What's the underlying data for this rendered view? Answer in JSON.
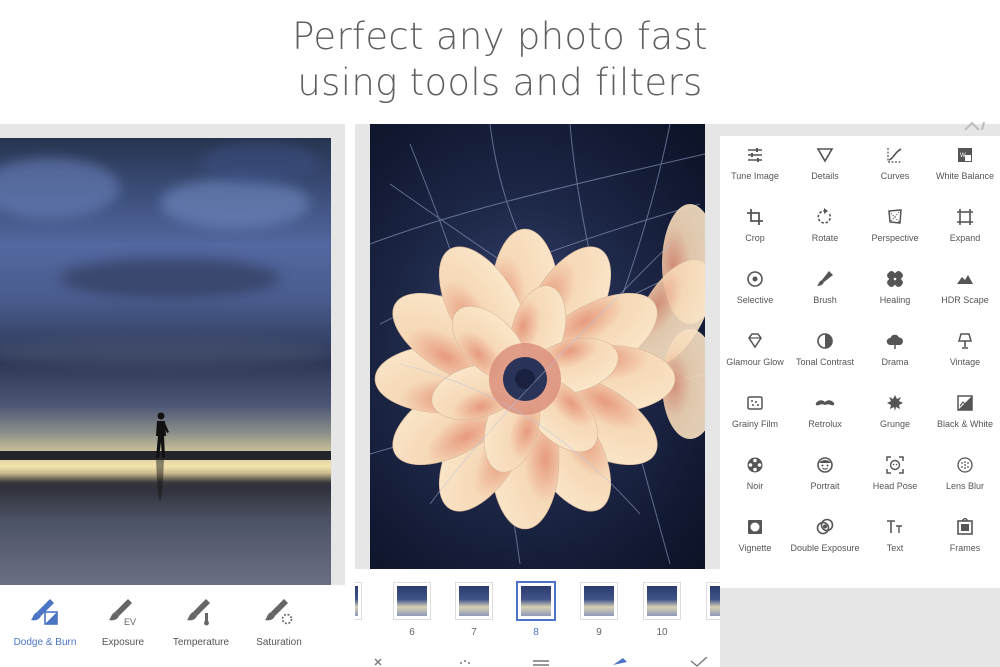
{
  "headline": {
    "line1": "Perfect any photo fast",
    "line2": "using tools and filters"
  },
  "left_toolbar": {
    "active_color": "#4b75c4",
    "items": [
      {
        "label": "Dodge & Burn",
        "icon": "dodge-burn-brush-icon",
        "active": true
      },
      {
        "label": "Exposure",
        "icon": "exposure-brush-icon",
        "active": false
      },
      {
        "label": "Temperature",
        "icon": "temperature-brush-icon",
        "active": false
      },
      {
        "label": "Saturation",
        "icon": "saturation-brush-icon",
        "active": false
      }
    ]
  },
  "filmstrip": {
    "selected": "8",
    "thumbs": [
      "6",
      "7",
      "8",
      "9",
      "10"
    ]
  },
  "tools": [
    {
      "label": "Tune Image",
      "icon": "tune-sliders-icon"
    },
    {
      "label": "Details",
      "icon": "details-triangle-icon"
    },
    {
      "label": "Curves",
      "icon": "curves-icon"
    },
    {
      "label": "White Balance",
      "icon": "white-balance-icon"
    },
    {
      "label": "Crop",
      "icon": "crop-icon"
    },
    {
      "label": "Rotate",
      "icon": "rotate-icon"
    },
    {
      "label": "Perspective",
      "icon": "perspective-icon"
    },
    {
      "label": "Expand",
      "icon": "expand-icon"
    },
    {
      "label": "Selective",
      "icon": "selective-target-icon"
    },
    {
      "label": "Brush",
      "icon": "brush-icon"
    },
    {
      "label": "Healing",
      "icon": "healing-bandage-icon"
    },
    {
      "label": "HDR Scape",
      "icon": "mountains-icon"
    },
    {
      "label": "Glamour Glow",
      "icon": "diamond-icon"
    },
    {
      "label": "Tonal Contrast",
      "icon": "tonal-contrast-icon"
    },
    {
      "label": "Drama",
      "icon": "cloud-icon"
    },
    {
      "label": "Vintage",
      "icon": "lamp-icon"
    },
    {
      "label": "Grainy Film",
      "icon": "grain-icon"
    },
    {
      "label": "Retrolux",
      "icon": "mustache-icon"
    },
    {
      "label": "Grunge",
      "icon": "grunge-icon"
    },
    {
      "label": "Black & White",
      "icon": "black-white-icon"
    },
    {
      "label": "Noir",
      "icon": "film-reel-icon"
    },
    {
      "label": "Portrait",
      "icon": "face-icon"
    },
    {
      "label": "Head Pose",
      "icon": "head-pose-icon"
    },
    {
      "label": "Lens Blur",
      "icon": "lens-blur-icon"
    },
    {
      "label": "Vignette",
      "icon": "vignette-icon"
    },
    {
      "label": "Double Exposure",
      "icon": "double-exposure-icon"
    },
    {
      "label": "Text",
      "icon": "text-tt-icon"
    },
    {
      "label": "Frames",
      "icon": "frames-icon"
    }
  ]
}
